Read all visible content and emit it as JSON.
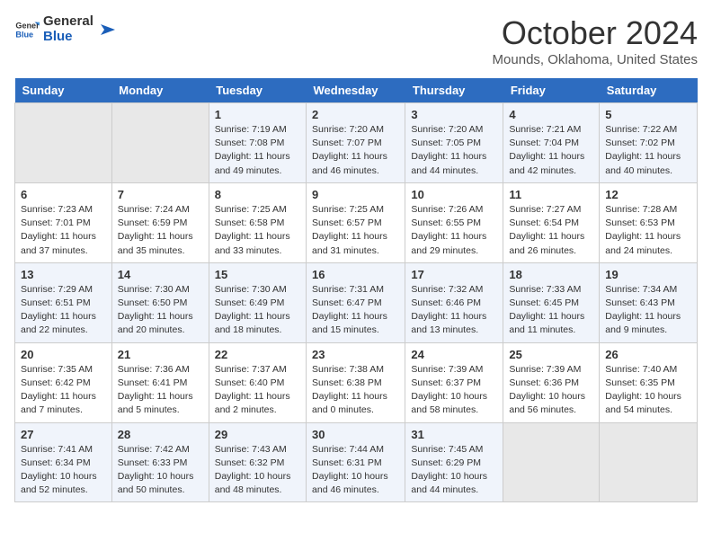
{
  "logo": {
    "line1": "General",
    "line2": "Blue"
  },
  "title": "October 2024",
  "subtitle": "Mounds, Oklahoma, United States",
  "days_header": [
    "Sunday",
    "Monday",
    "Tuesday",
    "Wednesday",
    "Thursday",
    "Friday",
    "Saturday"
  ],
  "weeks": [
    [
      {
        "num": "",
        "info": ""
      },
      {
        "num": "",
        "info": ""
      },
      {
        "num": "1",
        "info": "Sunrise: 7:19 AM\nSunset: 7:08 PM\nDaylight: 11 hours and 49 minutes."
      },
      {
        "num": "2",
        "info": "Sunrise: 7:20 AM\nSunset: 7:07 PM\nDaylight: 11 hours and 46 minutes."
      },
      {
        "num": "3",
        "info": "Sunrise: 7:20 AM\nSunset: 7:05 PM\nDaylight: 11 hours and 44 minutes."
      },
      {
        "num": "4",
        "info": "Sunrise: 7:21 AM\nSunset: 7:04 PM\nDaylight: 11 hours and 42 minutes."
      },
      {
        "num": "5",
        "info": "Sunrise: 7:22 AM\nSunset: 7:02 PM\nDaylight: 11 hours and 40 minutes."
      }
    ],
    [
      {
        "num": "6",
        "info": "Sunrise: 7:23 AM\nSunset: 7:01 PM\nDaylight: 11 hours and 37 minutes."
      },
      {
        "num": "7",
        "info": "Sunrise: 7:24 AM\nSunset: 6:59 PM\nDaylight: 11 hours and 35 minutes."
      },
      {
        "num": "8",
        "info": "Sunrise: 7:25 AM\nSunset: 6:58 PM\nDaylight: 11 hours and 33 minutes."
      },
      {
        "num": "9",
        "info": "Sunrise: 7:25 AM\nSunset: 6:57 PM\nDaylight: 11 hours and 31 minutes."
      },
      {
        "num": "10",
        "info": "Sunrise: 7:26 AM\nSunset: 6:55 PM\nDaylight: 11 hours and 29 minutes."
      },
      {
        "num": "11",
        "info": "Sunrise: 7:27 AM\nSunset: 6:54 PM\nDaylight: 11 hours and 26 minutes."
      },
      {
        "num": "12",
        "info": "Sunrise: 7:28 AM\nSunset: 6:53 PM\nDaylight: 11 hours and 24 minutes."
      }
    ],
    [
      {
        "num": "13",
        "info": "Sunrise: 7:29 AM\nSunset: 6:51 PM\nDaylight: 11 hours and 22 minutes."
      },
      {
        "num": "14",
        "info": "Sunrise: 7:30 AM\nSunset: 6:50 PM\nDaylight: 11 hours and 20 minutes."
      },
      {
        "num": "15",
        "info": "Sunrise: 7:30 AM\nSunset: 6:49 PM\nDaylight: 11 hours and 18 minutes."
      },
      {
        "num": "16",
        "info": "Sunrise: 7:31 AM\nSunset: 6:47 PM\nDaylight: 11 hours and 15 minutes."
      },
      {
        "num": "17",
        "info": "Sunrise: 7:32 AM\nSunset: 6:46 PM\nDaylight: 11 hours and 13 minutes."
      },
      {
        "num": "18",
        "info": "Sunrise: 7:33 AM\nSunset: 6:45 PM\nDaylight: 11 hours and 11 minutes."
      },
      {
        "num": "19",
        "info": "Sunrise: 7:34 AM\nSunset: 6:43 PM\nDaylight: 11 hours and 9 minutes."
      }
    ],
    [
      {
        "num": "20",
        "info": "Sunrise: 7:35 AM\nSunset: 6:42 PM\nDaylight: 11 hours and 7 minutes."
      },
      {
        "num": "21",
        "info": "Sunrise: 7:36 AM\nSunset: 6:41 PM\nDaylight: 11 hours and 5 minutes."
      },
      {
        "num": "22",
        "info": "Sunrise: 7:37 AM\nSunset: 6:40 PM\nDaylight: 11 hours and 2 minutes."
      },
      {
        "num": "23",
        "info": "Sunrise: 7:38 AM\nSunset: 6:38 PM\nDaylight: 11 hours and 0 minutes."
      },
      {
        "num": "24",
        "info": "Sunrise: 7:39 AM\nSunset: 6:37 PM\nDaylight: 10 hours and 58 minutes."
      },
      {
        "num": "25",
        "info": "Sunrise: 7:39 AM\nSunset: 6:36 PM\nDaylight: 10 hours and 56 minutes."
      },
      {
        "num": "26",
        "info": "Sunrise: 7:40 AM\nSunset: 6:35 PM\nDaylight: 10 hours and 54 minutes."
      }
    ],
    [
      {
        "num": "27",
        "info": "Sunrise: 7:41 AM\nSunset: 6:34 PM\nDaylight: 10 hours and 52 minutes."
      },
      {
        "num": "28",
        "info": "Sunrise: 7:42 AM\nSunset: 6:33 PM\nDaylight: 10 hours and 50 minutes."
      },
      {
        "num": "29",
        "info": "Sunrise: 7:43 AM\nSunset: 6:32 PM\nDaylight: 10 hours and 48 minutes."
      },
      {
        "num": "30",
        "info": "Sunrise: 7:44 AM\nSunset: 6:31 PM\nDaylight: 10 hours and 46 minutes."
      },
      {
        "num": "31",
        "info": "Sunrise: 7:45 AM\nSunset: 6:29 PM\nDaylight: 10 hours and 44 minutes."
      },
      {
        "num": "",
        "info": ""
      },
      {
        "num": "",
        "info": ""
      }
    ]
  ]
}
